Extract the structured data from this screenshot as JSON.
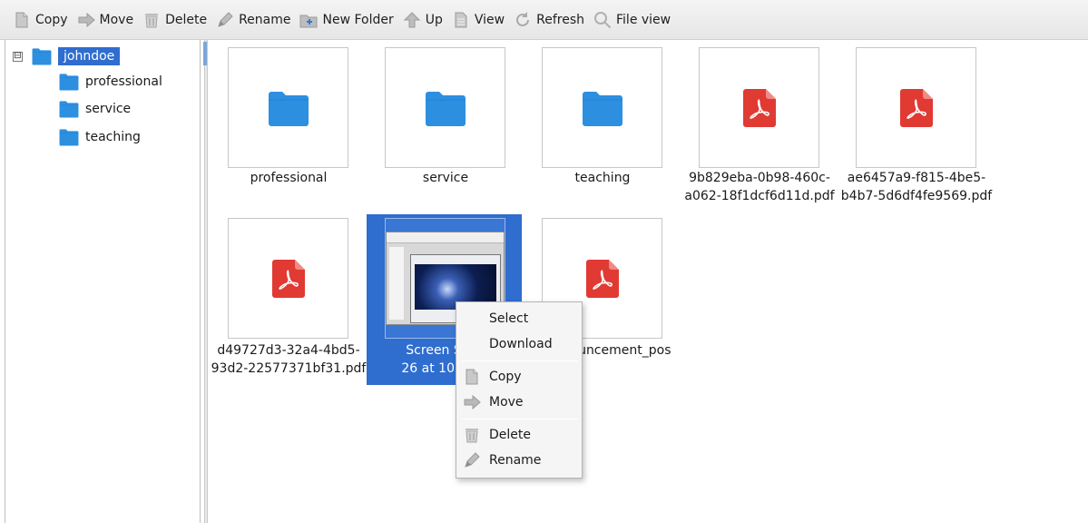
{
  "toolbar": {
    "items": [
      {
        "label": "Copy",
        "icon": "copy-icon"
      },
      {
        "label": "Move",
        "icon": "move-icon"
      },
      {
        "label": "Delete",
        "icon": "trash-icon"
      },
      {
        "label": "Rename",
        "icon": "pencil-icon"
      },
      {
        "label": "New Folder",
        "icon": "new-folder-icon"
      },
      {
        "label": "Up",
        "icon": "up-arrow-icon"
      },
      {
        "label": "View",
        "icon": "view-icon"
      },
      {
        "label": "Refresh",
        "icon": "refresh-icon"
      },
      {
        "label": "File view",
        "icon": "magnifier-icon"
      }
    ]
  },
  "tree": {
    "expander": "⊟",
    "root": {
      "label": "johndoe",
      "selected": true
    },
    "children": [
      {
        "label": "professional"
      },
      {
        "label": "service"
      },
      {
        "label": "teaching"
      }
    ]
  },
  "files": [
    {
      "name": "professional",
      "type": "folder"
    },
    {
      "name": "service",
      "type": "folder"
    },
    {
      "name": "teaching",
      "type": "folder"
    },
    {
      "name": "9b829eba-0b98-460c-\na062-18f1dcf6d11d.pdf",
      "type": "pdf"
    },
    {
      "name": "ae6457a9-f815-4be5-\nb4b7-5d6df4fe9569.pdf",
      "type": "pdf"
    },
    {
      "name": "d49727d3-32a4-4bd5-\n93d2-22577371bf31.pdf",
      "type": "pdf"
    },
    {
      "name": "Screen Shot\n26 at 10.56.2",
      "type": "image",
      "selected": true
    },
    {
      "name": "ouncement_pos",
      "type": "pdf"
    }
  ],
  "context_menu": {
    "items": [
      {
        "label": "Select",
        "icon": null
      },
      {
        "label": "Download",
        "icon": null
      },
      {
        "label": "Copy",
        "icon": "copy-icon"
      },
      {
        "label": "Move",
        "icon": "move-icon"
      },
      {
        "label": "Delete",
        "icon": "trash-icon"
      },
      {
        "label": "Rename",
        "icon": "pencil-icon"
      }
    ]
  },
  "colors": {
    "selection": "#2f6dcf",
    "folder": "#2d8fe0",
    "pdf": "#e03a33"
  }
}
